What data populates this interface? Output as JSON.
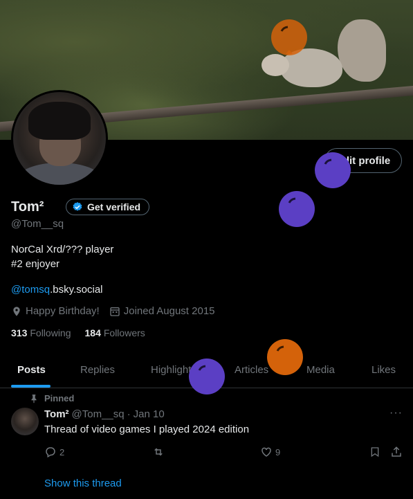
{
  "profile": {
    "name": "Tom²",
    "get_verified_label": "Get verified",
    "handle": "@Tom__sq",
    "bio_lines": [
      "NorCal Xrd/??? player",
      "#2 enjoyer"
    ],
    "link_handle": "@tomsq",
    "link_domain": ".bsky.social",
    "birthday": "Happy Birthday!",
    "joined": "Joined August 2015",
    "following_count": "313",
    "following_label": "Following",
    "followers_count": "184",
    "followers_label": "Followers",
    "edit_profile_label": "Edit profile"
  },
  "tabs": [
    {
      "label": "Posts",
      "active": true
    },
    {
      "label": "Replies",
      "active": false
    },
    {
      "label": "Highlights",
      "active": false
    },
    {
      "label": "Articles",
      "active": false
    },
    {
      "label": "Media",
      "active": false
    },
    {
      "label": "Likes",
      "active": false
    }
  ],
  "post": {
    "pinned_label": "Pinned",
    "author": "Tom²",
    "handle": "@Tom__sq",
    "separator": "·",
    "date": "Jan 10",
    "text": "Thread of video games I played 2024 edition",
    "reply_count": "2",
    "like_count": "9",
    "more_label": "···",
    "show_thread_label": "Show this thread"
  },
  "icons": [
    "reply-icon",
    "repost-icon",
    "like-icon",
    "bookmark-icon",
    "share-icon",
    "pin-icon",
    "location-icon",
    "calendar-icon",
    "verified-badge-icon",
    "balloon-icon"
  ],
  "colors": {
    "accent": "#1d9bf0",
    "background": "#000000",
    "muted": "#71767b",
    "balloon_purple": "#5b3fc4",
    "balloon_orange": "#d4620a"
  }
}
